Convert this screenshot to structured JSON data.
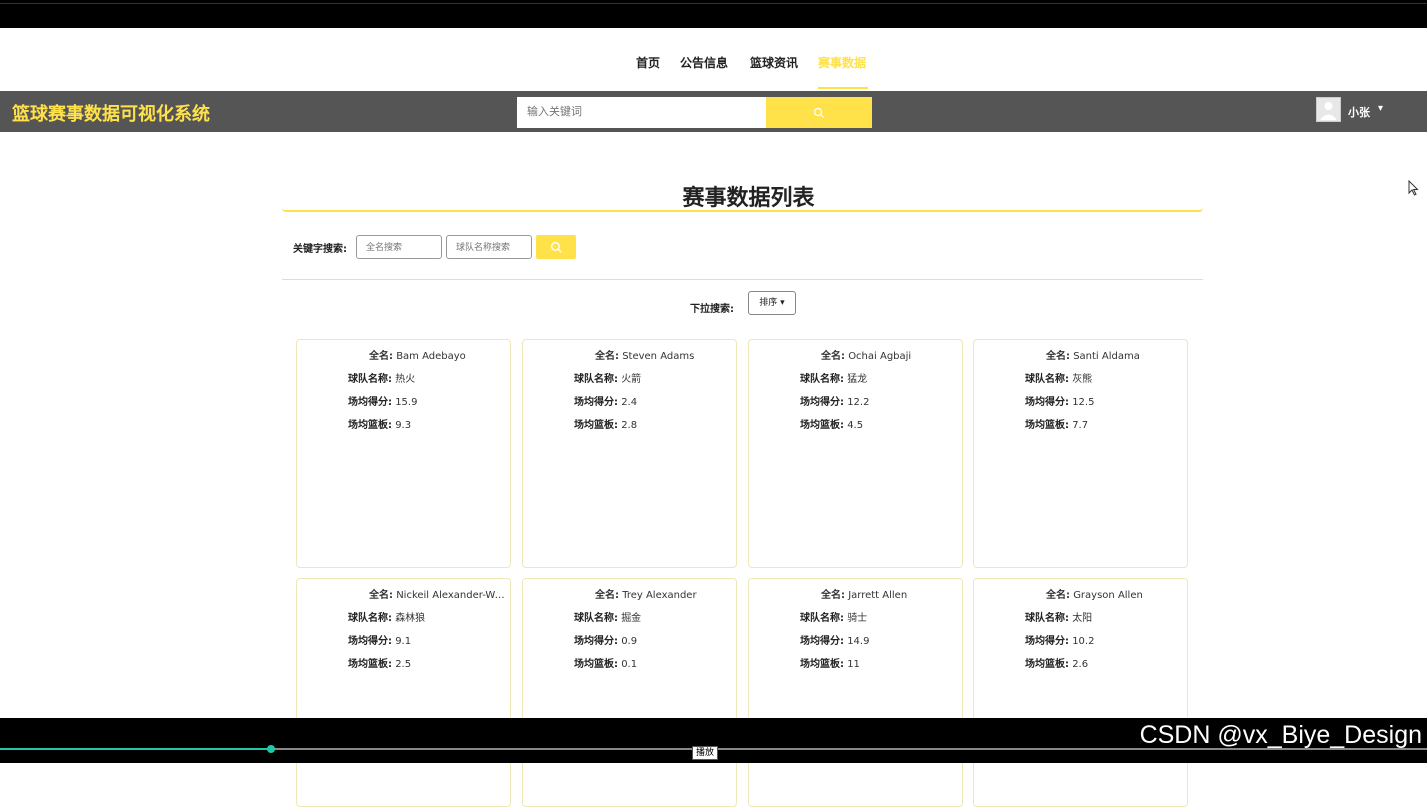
{
  "nav": {
    "items": [
      {
        "label": "首页"
      },
      {
        "label": "公告信息"
      },
      {
        "label": "篮球资讯"
      },
      {
        "label": "赛事数据"
      }
    ]
  },
  "header": {
    "site_title": "篮球赛事数据可视化系统",
    "search_placeholder": "输入关键词",
    "user_name": "小张",
    "user_caret": "▾"
  },
  "page": {
    "title": "赛事数据列表",
    "keyword_label": "关键字搜索:",
    "fullname_placeholder": "全名搜索",
    "team_placeholder": "球队名称搜索",
    "dropdown_label": "下拉搜索:",
    "sort_button": "排序 ▾"
  },
  "field_labels": {
    "fullname": "全名:",
    "team": "球队名称:",
    "points": "场均得分:",
    "rebounds": "场均篮板:"
  },
  "players": [
    {
      "fullname": "Bam Adebayo",
      "team": "热火",
      "points": "15.9",
      "rebounds": "9.3"
    },
    {
      "fullname": "Steven Adams",
      "team": "火箭",
      "points": "2.4",
      "rebounds": "2.8"
    },
    {
      "fullname": "Ochai Agbaji",
      "team": "猛龙",
      "points": "12.2",
      "rebounds": "4.5"
    },
    {
      "fullname": "Santi Aldama",
      "team": "灰熊",
      "points": "12.5",
      "rebounds": "7.7"
    },
    {
      "fullname": "Nickeil Alexander-Wa...",
      "team": "森林狼",
      "points": "9.1",
      "rebounds": "2.5"
    },
    {
      "fullname": "Trey Alexander",
      "team": "掘金",
      "points": "0.9",
      "rebounds": "0.1"
    },
    {
      "fullname": "Jarrett Allen",
      "team": "骑士",
      "points": "14.9",
      "rebounds": "11"
    },
    {
      "fullname": "Grayson Allen",
      "team": "太阳",
      "points": "10.2",
      "rebounds": "2.6"
    }
  ],
  "player_bar": {
    "watermark": "CSDN @vx_Biye_Design",
    "tooltip": "播放",
    "progress": 0.19
  },
  "colors": {
    "accent": "#ffe14a",
    "header_bg": "#555555",
    "progress": "#1fc9a8"
  }
}
